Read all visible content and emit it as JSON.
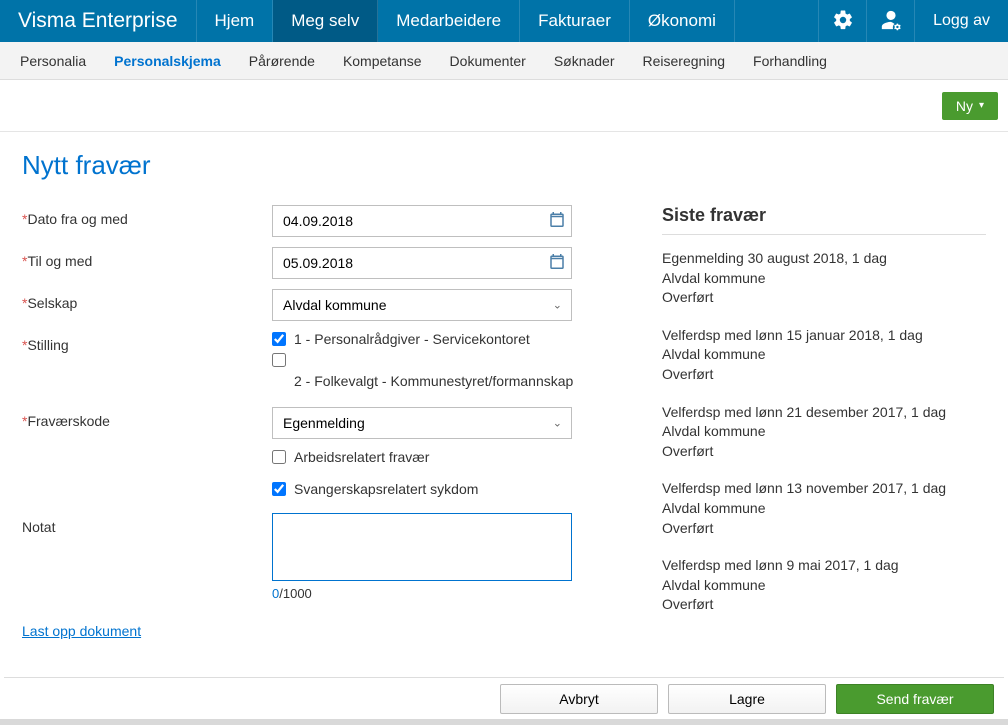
{
  "brand": "Visma Enterprise",
  "topnav": {
    "items": [
      {
        "label": "Hjem",
        "active": false
      },
      {
        "label": "Meg selv",
        "active": true
      },
      {
        "label": "Medarbeidere",
        "active": false
      },
      {
        "label": "Fakturaer",
        "active": false
      },
      {
        "label": "Økonomi",
        "active": false
      }
    ],
    "logout": "Logg av"
  },
  "subtabs": [
    {
      "label": "Personalia",
      "active": false
    },
    {
      "label": "Personalskjema",
      "active": true
    },
    {
      "label": "Pårørende",
      "active": false
    },
    {
      "label": "Kompetanse",
      "active": false
    },
    {
      "label": "Dokumenter",
      "active": false
    },
    {
      "label": "Søknader",
      "active": false
    },
    {
      "label": "Reiseregning",
      "active": false
    },
    {
      "label": "Forhandling",
      "active": false
    }
  ],
  "actionbar": {
    "new_label": "Ny"
  },
  "page_title": "Nytt fravær",
  "form": {
    "date_from_label": "Dato fra og med",
    "date_from_value": "04.09.2018",
    "date_to_label": "Til og med",
    "date_to_value": "05.09.2018",
    "company_label": "Selskap",
    "company_value": "Alvdal kommune",
    "position_label": "Stilling",
    "positions": [
      {
        "label": "1 - Personalrådgiver - Servicekontoret",
        "checked": true
      },
      {
        "label": "2 - Folkevalgt - Kommunestyret/formannskap",
        "checked": false
      }
    ],
    "absence_code_label": "Fraværskode",
    "absence_code_value": "Egenmelding",
    "work_related_label": "Arbeidsrelatert fravær",
    "work_related_checked": false,
    "pregnancy_label": "Svangerskapsrelatert sykdom",
    "pregnancy_checked": true,
    "note_label": "Notat",
    "note_value": "",
    "note_count_current": "0",
    "note_count_sep": "/",
    "note_count_max": "1000",
    "upload_label": "Last opp dokument"
  },
  "side": {
    "title": "Siste fravær",
    "items": [
      {
        "line1": "Egenmelding 30 august 2018, 1 dag",
        "line2": "Alvdal kommune",
        "line3": "Overført"
      },
      {
        "line1": "Velferdsp med lønn 15 januar 2018, 1 dag",
        "line2": "Alvdal kommune",
        "line3": "Overført"
      },
      {
        "line1": "Velferdsp med lønn 21 desember 2017, 1 dag",
        "line2": "Alvdal kommune",
        "line3": "Overført"
      },
      {
        "line1": "Velferdsp med lønn 13 november 2017, 1 dag",
        "line2": "Alvdal kommune",
        "line3": "Overført"
      },
      {
        "line1": "Velferdsp med lønn 9 mai 2017, 1 dag",
        "line2": "Alvdal kommune",
        "line3": "Overført"
      }
    ]
  },
  "footer": {
    "cancel": "Avbryt",
    "save": "Lagre",
    "send": "Send fravær"
  }
}
